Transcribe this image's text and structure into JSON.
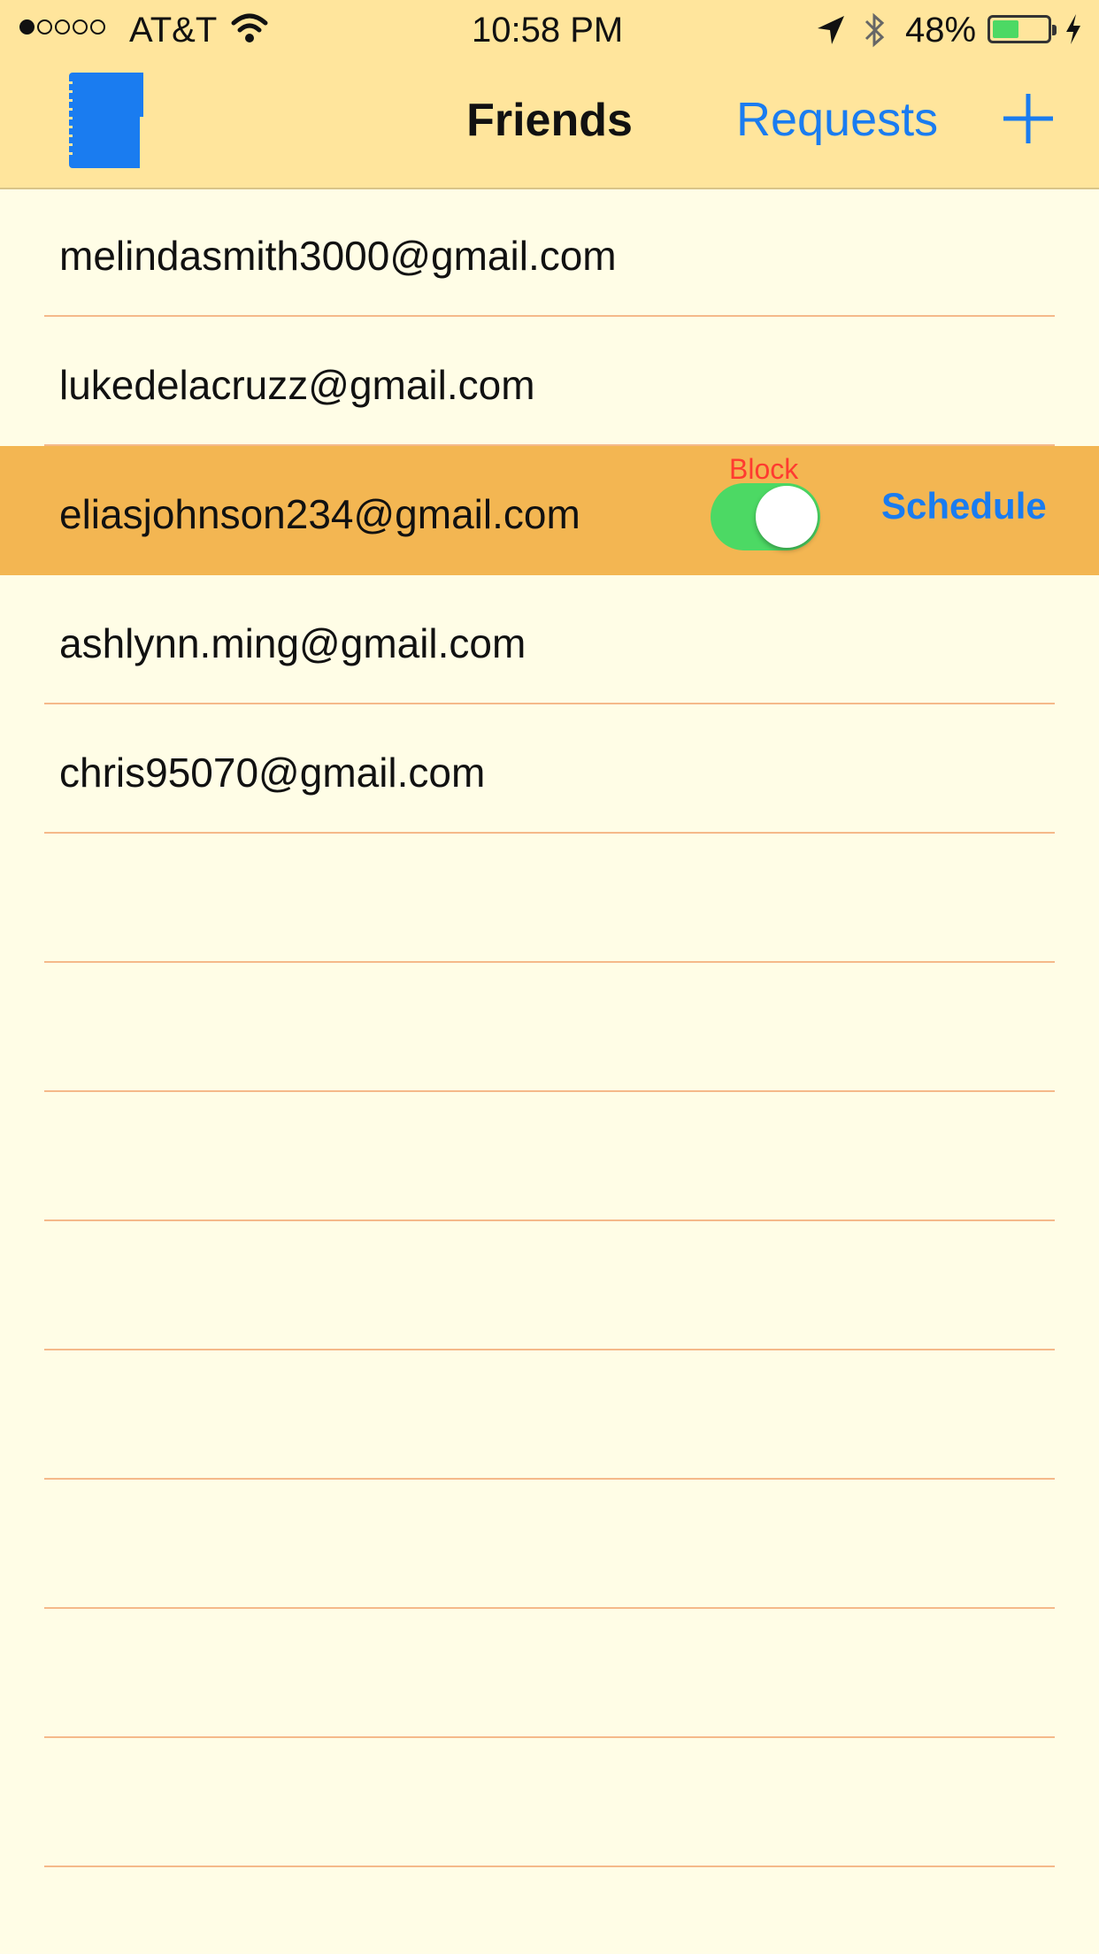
{
  "status_bar": {
    "carrier": "AT&T",
    "time": "10:58 PM",
    "battery_percent": "48%",
    "battery_level": 0.48,
    "signal_bars_filled": 1,
    "signal_bars_total": 5
  },
  "nav": {
    "title": "Friends",
    "requests_label": "Requests",
    "add_icon": "plus-icon",
    "left_icon": "notebook-icon"
  },
  "friends": [
    {
      "email": "melindasmith3000@gmail.com"
    },
    {
      "email": "lukedelacruzz@gmail.com"
    },
    {
      "email": "eliasjohnson234@gmail.com",
      "selected": true,
      "block_label": "Block",
      "block_on": true,
      "schedule_label": "Schedule"
    },
    {
      "email": "ashlynn.ming@gmail.com"
    },
    {
      "email": "chris95070@gmail.com"
    }
  ],
  "colors": {
    "header_bg": "#ffe59c",
    "list_bg": "#fffde6",
    "selected_row": "#f3b652",
    "accent_blue": "#1a7cf0",
    "separator": "#f5b98a",
    "toggle_on": "#4cd964",
    "block_red": "#ff3b30"
  }
}
